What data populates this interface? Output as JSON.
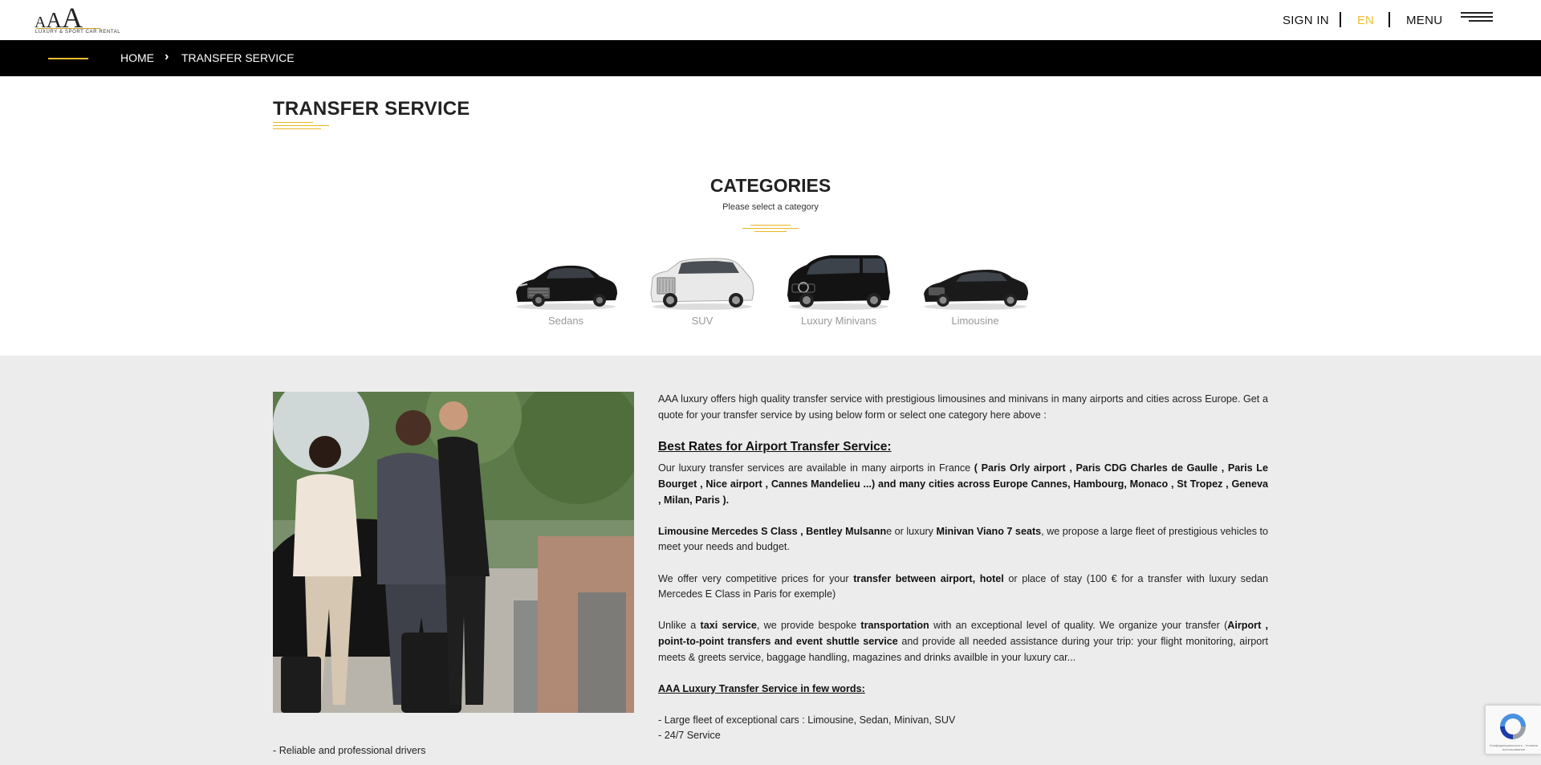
{
  "header": {
    "logo_text": "AAA",
    "logo_tagline": "LUXURY & SPORT CAR RENTAL",
    "sign_in": "SIGN IN",
    "language": "EN",
    "menu": "MENU"
  },
  "breadcrumb": {
    "home": "HOME",
    "current": "TRANSFER SERVICE"
  },
  "page": {
    "title": "TRANSFER SERVICE"
  },
  "categories": {
    "title": "CATEGORIES",
    "subtitle": "Please select a category",
    "items": [
      {
        "label": "Sedans",
        "icon": "sedan-car-image"
      },
      {
        "label": "SUV",
        "icon": "suv-car-image"
      },
      {
        "label": "Luxury Minivans",
        "icon": "minivan-car-image"
      },
      {
        "label": "Limousine",
        "icon": "limousine-car-image"
      }
    ]
  },
  "content": {
    "intro": "AAA luxury offers high quality transfer service with prestigious limousines and minivans in many airports and cities across Europe. Get a quote for your transfer service by using below form or select one category here above :",
    "rates_heading": "Best Rates for Airport Transfer Service:",
    "para1_a": "Our luxury transfer services are available in many airports in France ",
    "para1_b": "( Paris Orly airport , Paris CDG Charles de Gaulle , Paris Le Bourget , Nice airport , Cannes Mandelieu ...) and many cities across Europe  Cannes, Hambourg, Monaco , St Tropez , Geneva , Milan, Paris ).",
    "para2_a": "Limousine Mercedes S Class , Bentley Mulsann",
    "para2_b": "e or luxury ",
    "para2_c": "Minivan Viano 7 seats",
    "para2_d": ", we propose a large fleet of prestigious vehicles to meet your needs and budget.",
    "para3_a": "We offer very competitive prices for your ",
    "para3_b": "transfer between airport, hotel",
    "para3_c": " or place of stay (100 € for a transfer with luxury sedan Mercedes E Class in Paris for exemple)",
    "para4_a": "Unlike a ",
    "para4_b": "taxi service",
    "para4_c": ", we provide bespoke ",
    "para4_d": "transportation",
    "para4_e": " with an exceptional level of quality. We organize your transfer (",
    "para4_f": "Airport , point-to-point transfers and event shuttle service",
    "para4_g": "  and provide all needed assistance during your trip: your flight monitoring, airport meets & greets service, baggage handling, magazines and drinks availble in your luxury car...",
    "words_heading": "AAA Luxury Transfer Service in few words:",
    "bullets": [
      "- Large fleet of exceptional cars : Limousine, Sedan, Minivan, SUV",
      "- 24/7 Service"
    ],
    "left_bullet": "- Reliable and professional drivers"
  },
  "recaptcha": {
    "text": "Конфиденциальность - Условия использования"
  },
  "colors": {
    "accent": "#f0c030",
    "breadcrumb_bg": "#000000",
    "section_bg": "#ececec"
  }
}
